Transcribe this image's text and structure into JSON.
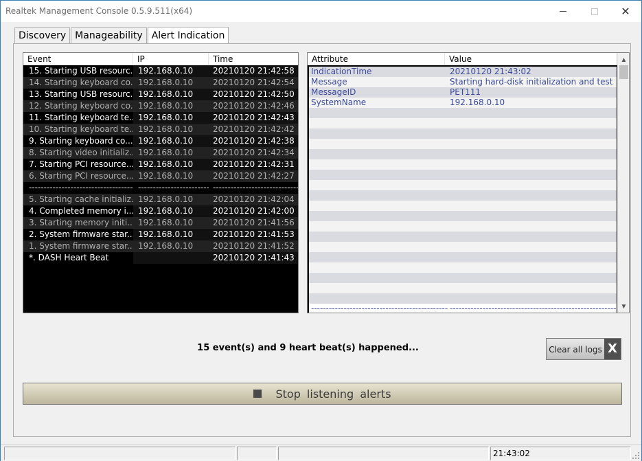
{
  "window": {
    "title": "Realtek Management Console 0.5.9.511(x64)"
  },
  "tabs": [
    {
      "label": "Discovery"
    },
    {
      "label": "Manageability"
    },
    {
      "label": "Alert Indication"
    }
  ],
  "events_table": {
    "headers": [
      "Event",
      "IP",
      "Time"
    ],
    "rows": [
      {
        "event": "15. Starting USB resourc...",
        "ip": "192.168.0.10",
        "time": "20210120 21:42:58"
      },
      {
        "event": "14. Starting keyboard co...",
        "ip": "192.168.0.10",
        "time": "20210120 21:42:54"
      },
      {
        "event": "13. Starting USB resourc...",
        "ip": "192.168.0.10",
        "time": "20210120 21:42:50"
      },
      {
        "event": "12. Starting keyboard co...",
        "ip": "192.168.0.10",
        "time": "20210120 21:42:46"
      },
      {
        "event": "11. Starting keyboard te...",
        "ip": "192.168.0.10",
        "time": "20210120 21:42:43"
      },
      {
        "event": "10. Starting keyboard te...",
        "ip": "192.168.0.10",
        "time": "20210120 21:42:42"
      },
      {
        "event": " 9. Starting keyboard co...",
        "ip": "192.168.0.10",
        "time": "20210120 21:42:38"
      },
      {
        "event": " 8. Starting video initializ...",
        "ip": "192.168.0.10",
        "time": "20210120 21:42:34"
      },
      {
        "event": " 7. Starting PCI resource...",
        "ip": "192.168.0.10",
        "time": "20210120 21:42:31"
      },
      {
        "event": " 6. Starting PCI resource...",
        "ip": "192.168.0.10",
        "time": "20210120 21:42:27"
      },
      {
        "event": "-------------------------------------",
        "ip": "---------------------------",
        "time": "---------------------------------",
        "sep": true
      },
      {
        "event": " 5. Starting cache initializ...",
        "ip": "192.168.0.10",
        "time": "20210120 21:42:04"
      },
      {
        "event": " 4. Completed memory i...",
        "ip": "192.168.0.10",
        "time": "20210120 21:42:00"
      },
      {
        "event": " 3. Starting memory initi...",
        "ip": "192.168.0.10",
        "time": "20210120 21:41:56"
      },
      {
        "event": " 2. System firmware star...",
        "ip": "192.168.0.10",
        "time": "20210120 21:41:53"
      },
      {
        "event": " 1. System firmware star...",
        "ip": "192.168.0.10",
        "time": "20210120 21:41:52"
      },
      {
        "event": " *. DASH Heart Beat",
        "ip": "",
        "time": "20210120 21:41:43"
      }
    ]
  },
  "attributes_table": {
    "headers": [
      "Attribute",
      "Value"
    ],
    "rows": [
      {
        "key": "IndicationTime",
        "value": "20210120 21:43:02"
      },
      {
        "key": "Message",
        "value": "Starting hard-disk initialization and test"
      },
      {
        "key": "MessageID",
        "value": "PET111"
      },
      {
        "key": "SystemName",
        "value": "192.168.0.10"
      }
    ],
    "separator_key": "------------------------------------------------------------",
    "separator_value": "----------------------------------------------------------------"
  },
  "summary": "15 event(s) and 9 heart beat(s) happened...",
  "clear_button": {
    "label": "Clear all logs",
    "icon_glyph": "X"
  },
  "stop_button": {
    "label": "Stop  listening  alerts"
  },
  "statusbar": {
    "cells": [
      "",
      "",
      "",
      "21:43:02"
    ]
  }
}
